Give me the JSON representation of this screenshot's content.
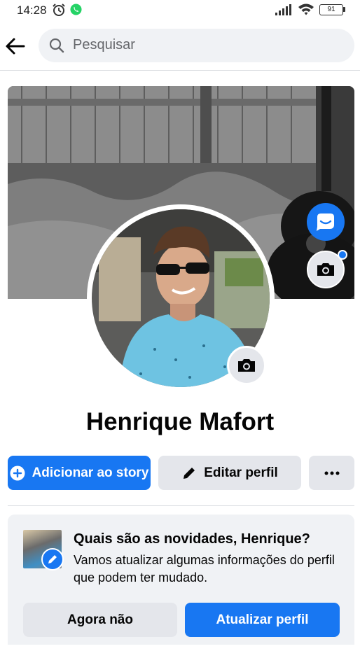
{
  "status_bar": {
    "time": "14:28",
    "battery": "91",
    "icons": [
      "alarm-icon",
      "whatsapp-icon",
      "signal-icon",
      "wifi-icon",
      "battery-icon"
    ]
  },
  "header": {
    "back_icon": "arrow-left-icon",
    "search_placeholder": "Pesquisar",
    "search_icon": "search-icon"
  },
  "profile": {
    "name": "Henrique Mafort",
    "cover_icons": [
      "messenger-icon",
      "camera-icon"
    ],
    "avatar_icon": "camera-icon"
  },
  "actions": {
    "add_story": "Adicionar ao story",
    "edit_profile": "Editar perfil",
    "more_icon": "ellipsis-icon"
  },
  "update_card": {
    "title": "Quais são as novidades, Henrique?",
    "text": "Vamos atualizar algumas informações do perfil que podem ter mudado.",
    "not_now": "Agora não",
    "update_profile": "Atualizar perfil"
  },
  "colors": {
    "accent": "#1877f2",
    "button_gray": "#e4e6eb",
    "card_bg": "#f0f2f5"
  }
}
